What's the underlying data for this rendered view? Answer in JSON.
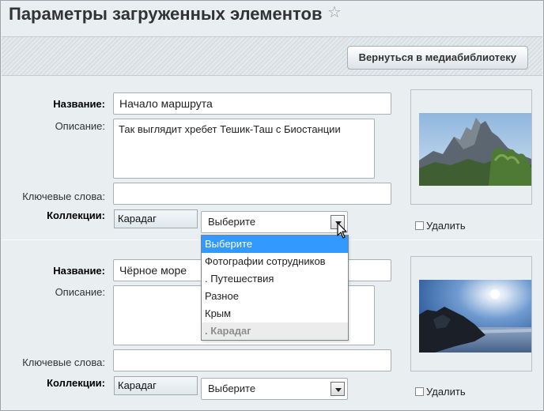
{
  "title": "Параметры загруженных элементов",
  "toolbar": {
    "back_label": "Вернуться в медиабиблиотеку"
  },
  "labels": {
    "name": "Название:",
    "description": "Описание:",
    "keywords": "Ключевые слова:",
    "collections": "Коллекции:",
    "delete": "Удалить"
  },
  "items": [
    {
      "name_value": "Начало маршрута",
      "description_value": "Так выглядит хребет Тешик-Таш  с Биостанции",
      "keywords_value": "",
      "collection_tag": "Карадаг",
      "collection_select": "Выберите"
    },
    {
      "name_value": "Чёрное море",
      "description_value": "",
      "keywords_value": "",
      "collection_tag": "Карадаг",
      "collection_select": "Выберите"
    }
  ],
  "dropdown": {
    "options": [
      "Выберите",
      "Фотографии сотрудников",
      ". Путешествия",
      "Разное",
      "Крым",
      ". Карадаг"
    ],
    "highlighted_index": 0
  },
  "colors": {
    "highlight": "#3399ff",
    "background": "#e9eff1"
  }
}
